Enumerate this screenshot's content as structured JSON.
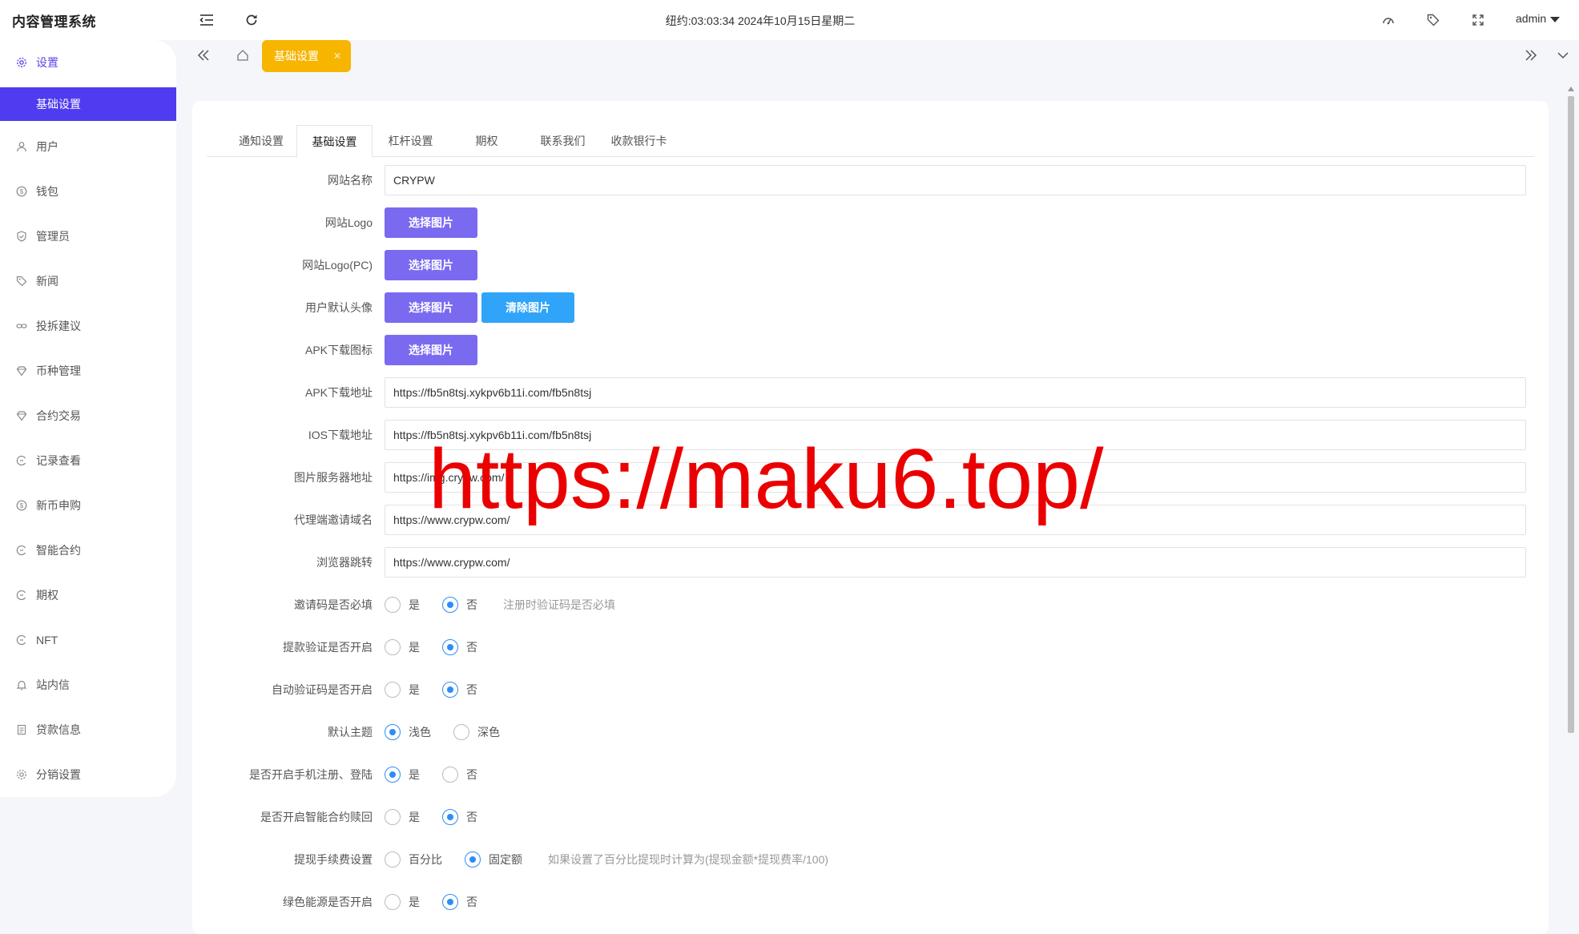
{
  "app": {
    "title": "内容管理系统"
  },
  "header": {
    "clock": "纽约:03:03:34 2024年10月15日星期二",
    "user": "admin"
  },
  "sidebar": {
    "parent": {
      "label": "设置",
      "icon": "gear-icon"
    },
    "active_sub": {
      "label": "基础设置"
    },
    "items": [
      {
        "label": "用户",
        "icon": "user-icon"
      },
      {
        "label": "钱包",
        "icon": "dollar-icon"
      },
      {
        "label": "管理员",
        "icon": "shield-icon"
      },
      {
        "label": "新闻",
        "icon": "tag-icon"
      },
      {
        "label": "投拆建议",
        "icon": "link-icon"
      },
      {
        "label": "币种管理",
        "icon": "diamond-icon"
      },
      {
        "label": "合约交易",
        "icon": "diamond-icon"
      },
      {
        "label": "记录查看",
        "icon": "record-icon"
      },
      {
        "label": "新币申购",
        "icon": "dollar-icon"
      },
      {
        "label": "智能合约",
        "icon": "record-icon"
      },
      {
        "label": "期权",
        "icon": "record-icon"
      },
      {
        "label": "NFT",
        "icon": "record-icon"
      },
      {
        "label": "站内信",
        "icon": "bell-icon"
      },
      {
        "label": "贷款信息",
        "icon": "doc-icon"
      },
      {
        "label": "分销设置",
        "icon": "gear-icon"
      }
    ]
  },
  "tagbar": {
    "active_tag": "基础设置"
  },
  "tabs": [
    {
      "label": "通知设置"
    },
    {
      "label": "基础设置"
    },
    {
      "label": "杠杆设置"
    },
    {
      "label": "期权"
    },
    {
      "label": "联系我们"
    },
    {
      "label": "收款银行卡"
    }
  ],
  "form": {
    "site_name": {
      "label": "网站名称",
      "value": "CRYPW"
    },
    "logo": {
      "label": "网站Logo",
      "button": "选择图片"
    },
    "logo_pc": {
      "label": "网站Logo(PC)",
      "button": "选择图片"
    },
    "avatar": {
      "label": "用户默认头像",
      "button": "选择图片",
      "clear_button": "清除图片"
    },
    "apk_icon": {
      "label": "APK下载图标",
      "button": "选择图片"
    },
    "apk_url": {
      "label": "APK下载地址",
      "value": "https://fb5n8tsj.xykpv6b11i.com/fb5n8tsj"
    },
    "ios_url": {
      "label": "IOS下载地址",
      "value": "https://fb5n8tsj.xykpv6b11i.com/fb5n8tsj"
    },
    "image_server": {
      "label": "图片服务器地址",
      "value": "https://img.crypw.com/"
    },
    "agent_domain": {
      "label": "代理端邀请域名",
      "value": "https://www.crypw.com/"
    },
    "browser_redirect": {
      "label": "浏览器跳转",
      "value": "https://www.crypw.com/"
    },
    "radios": [
      {
        "label": "邀请码是否必填",
        "options": [
          "是",
          "否"
        ],
        "selected": 1,
        "hint": "注册时验证码是否必填"
      },
      {
        "label": "提款验证是否开启",
        "options": [
          "是",
          "否"
        ],
        "selected": 1,
        "hint": ""
      },
      {
        "label": "自动验证码是否开启",
        "options": [
          "是",
          "否"
        ],
        "selected": 1,
        "hint": ""
      },
      {
        "label": "默认主题",
        "options": [
          "浅色",
          "深色"
        ],
        "selected": 0,
        "hint": ""
      },
      {
        "label": "是否开启手机注册、登陆",
        "options": [
          "是",
          "否"
        ],
        "selected": 0,
        "hint": ""
      },
      {
        "label": "是否开启智能合约赎回",
        "options": [
          "是",
          "否"
        ],
        "selected": 1,
        "hint": ""
      },
      {
        "label": "提现手续费设置",
        "options": [
          "百分比",
          "固定额"
        ],
        "selected": 1,
        "hint": "如果设置了百分比提现时计算为(提现金额*提现费率/100)"
      },
      {
        "label": "绿色能源是否开启",
        "options": [
          "是",
          "否"
        ],
        "selected": 1,
        "hint": ""
      }
    ]
  },
  "watermark": "https://maku6.top/"
}
